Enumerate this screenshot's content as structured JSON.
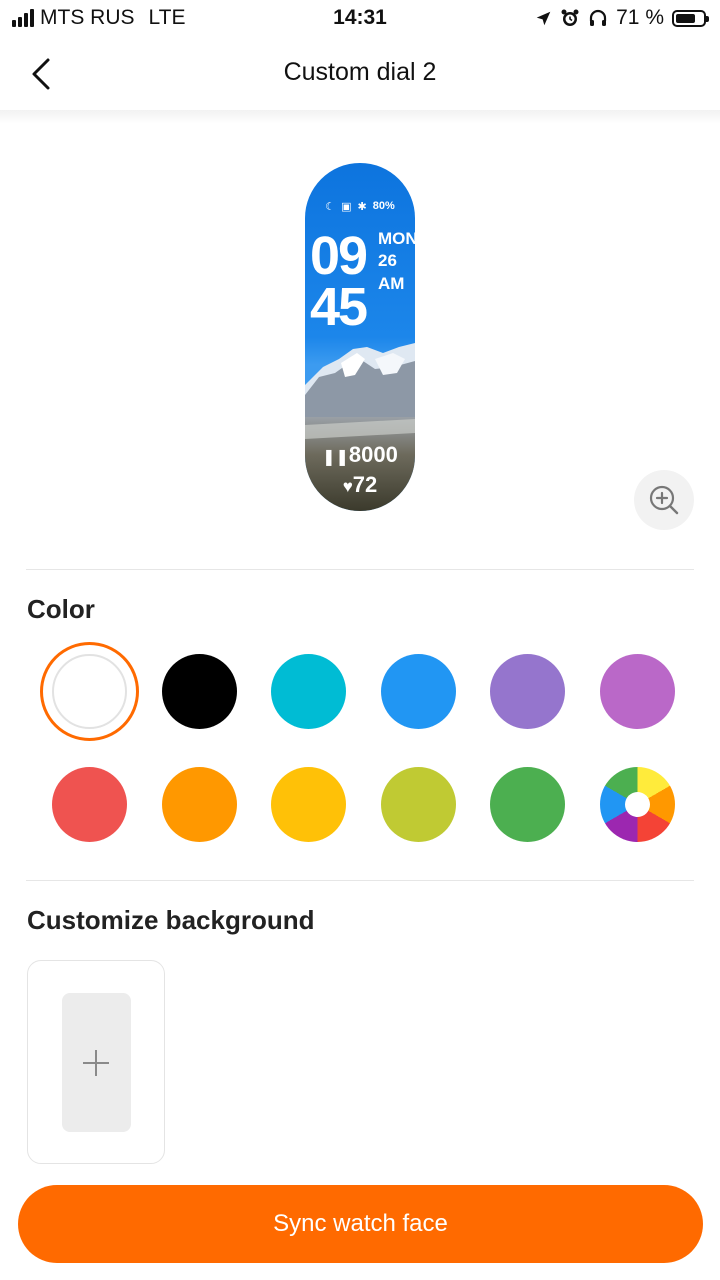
{
  "status_bar": {
    "carrier": "MTS RUS",
    "network": "LTE",
    "time": "14:31",
    "battery_percent": "71 %",
    "signal_bars": 4,
    "icons": [
      "location-arrow-icon",
      "alarm-icon",
      "headphones-icon",
      "battery-icon"
    ]
  },
  "header": {
    "title": "Custom dial 2",
    "back_icon": "chevron-left-icon"
  },
  "preview": {
    "battery": "80%",
    "hour": "09",
    "minute": "45",
    "day": "MON",
    "date": "26",
    "ampm": "AM",
    "steps": "8000",
    "heart_rate": "72",
    "zoom_icon": "zoom-in-icon"
  },
  "color_section": {
    "title": "Color",
    "selected_index": 0,
    "swatches": [
      {
        "name": "white",
        "color": "#ffffff"
      },
      {
        "name": "black",
        "color": "#000000"
      },
      {
        "name": "cyan",
        "color": "#00bcd4"
      },
      {
        "name": "blue",
        "color": "#2196f3"
      },
      {
        "name": "lavender",
        "color": "#9575cd"
      },
      {
        "name": "orchid",
        "color": "#ba68c8"
      },
      {
        "name": "red",
        "color": "#ef5350"
      },
      {
        "name": "orange",
        "color": "#ff9800"
      },
      {
        "name": "amber",
        "color": "#ffc107"
      },
      {
        "name": "lime",
        "color": "#c0ca33"
      },
      {
        "name": "green",
        "color": "#4caf50"
      },
      {
        "name": "custom-wheel",
        "color": "multicolor"
      }
    ]
  },
  "background_section": {
    "title": "Customize background",
    "add_icon": "plus-icon"
  },
  "sync_button": {
    "label": "Sync watch face"
  },
  "theme": {
    "accent": "#ff6a00"
  }
}
